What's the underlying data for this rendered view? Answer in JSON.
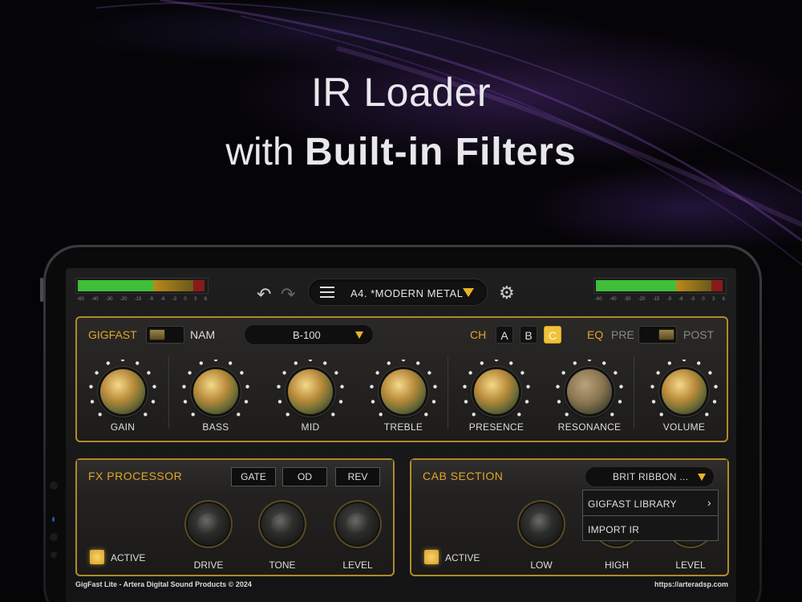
{
  "headline": {
    "line1": "IR Loader",
    "line2_light": "with",
    "line2_bold": "Built-in Filters"
  },
  "topbar": {
    "meter_scale": [
      "-60",
      "-40",
      "-30",
      "-20",
      "-15",
      "-9",
      "-6",
      "-3",
      "0",
      "3",
      "6"
    ],
    "left_meter_level": 0.58,
    "right_meter_level": 0.62,
    "undo_icon": "undo-icon",
    "redo_icon": "redo-icon",
    "preset_name": "A4. *MODERN METAL",
    "settings_icon": "gear-icon"
  },
  "amp": {
    "gigfast_label": "GIGFAST",
    "nam_label": "NAM",
    "model_value": "B-100",
    "ch_label": "CH",
    "channels": [
      "A",
      "B",
      "C"
    ],
    "active_channel": "C",
    "eq_label": "EQ",
    "pre_label": "PRE",
    "post_label": "POST",
    "knobs": [
      "GAIN",
      "BASS",
      "MID",
      "TREBLE",
      "PRESENCE",
      "RESONANCE",
      "VOLUME"
    ]
  },
  "fx": {
    "title": "FX PROCESSOR",
    "buttons": [
      "GATE",
      "OD",
      "REV"
    ],
    "active_label": "ACTIVE",
    "knobs": [
      "DRIVE",
      "TONE",
      "LEVEL"
    ]
  },
  "cab": {
    "title": "CAB SECTION",
    "selected": "BRIT RIBBON ...",
    "dropdown": [
      "GIGFAST LIBRARY",
      "IMPORT IR"
    ],
    "active_label": "ACTIVE",
    "knobs": [
      "LOW",
      "HIGH",
      "LEVEL"
    ]
  },
  "footer": {
    "left": "GigFast Lite - Artera Digital Sound Products © 2024",
    "right": "https://arteradsp.com"
  },
  "colors": {
    "accent": "#e3a52a",
    "panel_border": "#b08a2a",
    "meter_green": "#3fbf3a",
    "meter_amber": "#b98a1a",
    "meter_red": "#8a1a1a"
  }
}
